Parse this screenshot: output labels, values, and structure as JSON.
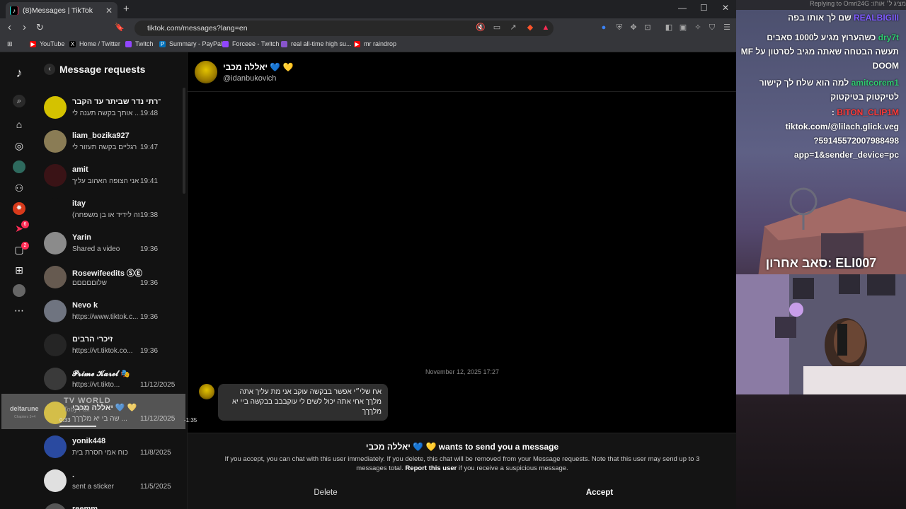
{
  "browser": {
    "tab_title": "(8)Messages | TikTok",
    "url": "tiktok.com/messages?lang=en",
    "bookmarks": [
      "YouTube",
      "Home / Twitter",
      "Twitch",
      "Summary - PayPal",
      "Forceee - Twitch",
      "real all-time high su...",
      "mr raindrop"
    ]
  },
  "rail": {
    "badges": {
      "inbox_count": "6",
      "messages_count": "2"
    }
  },
  "requests": {
    "title": "Message requests",
    "items": [
      {
        "name": "נדרתי נדר שביתר עד הקבר ...",
        "preview": "אותך בקשה תענה לי ...",
        "time": "19:48",
        "avatar_color": "#d4c200"
      },
      {
        "name": "liam_bozika927",
        "preview": "רגליים בקשה תעזור לי ...",
        "time": "19:47",
        "avatar_color": "#8a7c55"
      },
      {
        "name": "amit",
        "preview": "היי אני הצופה האהוב עליך",
        "time": "19:41",
        "avatar_color": "#3a1316"
      },
      {
        "name": "itay",
        "preview": "(זה לידיד או בן משפחה",
        "time": "19:38",
        "avatar_color": "#121212"
      },
      {
        "name": "Yarin",
        "preview": "Shared a video",
        "time": "19:36",
        "avatar_color": "#8b8b8b"
      },
      {
        "name": "Rosewifeedits ⓈⒺ",
        "preview": "שלוםםםםם",
        "time": "19:36",
        "avatar_color": "#665a50"
      },
      {
        "name": "Nevo k",
        "preview": "https://www.tiktok.c...",
        "time": "19:36",
        "avatar_color": "#6f7480"
      },
      {
        "name": "זיכרי הרבים",
        "preview": "https://vt.tiktok.co...",
        "time": "19:36",
        "avatar_color": "#252525"
      },
      {
        "name": "𝓟𝓻𝓲𝓶𝓮 𝓚𝓪𝓻𝓮𝓵 🎭",
        "preview": "https://vt.tikto...",
        "time": "11/12/2025",
        "avatar_color": "#3a3a3a"
      },
      {
        "name": "יאללה מכבי 💙 💛",
        "preview": "שה בי יא מלךךך ...",
        "time": "11/12/2025",
        "avatar_color": "#d6b400"
      },
      {
        "name": "yonik448",
        "preview": "כוח אמי חסרת בית",
        "time": "11/8/2025",
        "avatar_color": "#2a4aa0"
      },
      {
        "name": ".",
        "preview": "sent a sticker",
        "time": "11/5/2025",
        "avatar_color": "#e0e0e0"
      },
      {
        "name": "reemm",
        "preview": "",
        "time": "",
        "avatar_color": "#555555"
      }
    ]
  },
  "chat": {
    "name": "יאללה מכבי 💙 💛",
    "handle": "@idanbukovich",
    "date": "November 12, 2025 17:27",
    "message": "אח שלי״י אפשר בבקשה עוקב אני מת עליך אתה מלךך אחי אתה יכול לשים לי עוקבבב בבקשה ביי יא מלךךך",
    "request_title": "יאללה מכבי 💙 💛 wants to send you a message",
    "request_body_1": "If you accept, you can chat with this user immediately. If you delete, this chat will be removed from your Message requests. Note that this user may send up to 3 messages total.",
    "request_link": "Report this user",
    "request_body_2": "if you receive a suspicious message.",
    "delete_label": "Delete",
    "accept_label": "Accept"
  },
  "overlay": {
    "title": "TV WORLD",
    "subtitle": "Toby Fox",
    "logo": "deltarune",
    "logo_sub": "Chapters 3+4",
    "time_elapsed": "0:33",
    "time_remaining": "-1:35"
  },
  "stream": {
    "topbar": "מציג ל׳ אותו: Replying to Omri24G",
    "chat": [
      {
        "user": "REALBIGIII",
        "text": "שם לך אותו בפה"
      },
      {
        "user": "dry7t",
        "text": "כשהערוץ מגיע ל1000 סאבים"
      },
      {
        "user": "",
        "text": "תעשה הבטחה שאתה מגיב לסרטון על MF"
      },
      {
        "user": "",
        "text": "DOOM"
      },
      {
        "user": "amitcorem1",
        "text": "למה הוא שלח לך קישור"
      },
      {
        "user": "",
        "text": "לטיקטוק בטיקטוק"
      },
      {
        "user": "BITON_CLIP1M",
        "text": ":"
      },
      {
        "user": "",
        "text": "tiktok.com/@lilach.glick.veg"
      },
      {
        "user": "",
        "text": "59145572007988498?"
      },
      {
        "user": "",
        "text": "app=1&sender_device=pc"
      }
    ],
    "last_sub": "סאב אחרון: ELI007"
  }
}
